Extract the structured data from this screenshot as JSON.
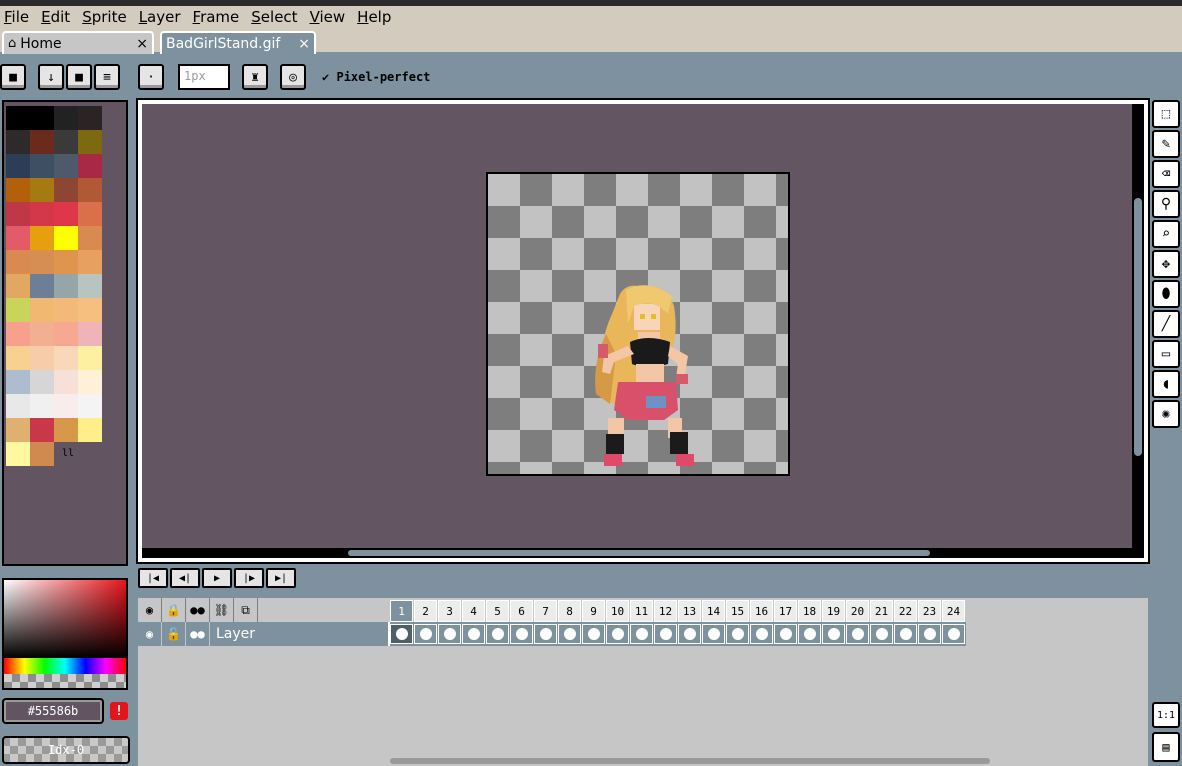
{
  "menubar": {
    "items": [
      "File",
      "Edit",
      "Sprite",
      "Layer",
      "Frame",
      "Select",
      "View",
      "Help"
    ]
  },
  "tabs": {
    "home": {
      "icon": "home-icon",
      "label": "Home",
      "close": "×"
    },
    "file": {
      "label": "BadGirlStand.gif",
      "close": "×"
    }
  },
  "toolbar": {
    "lock_icon": "lock-icon",
    "brush_size_value": "1px",
    "pixel_perfect_label": "Pixel-perfect",
    "pixel_perfect_checked": true
  },
  "palette": {
    "colors": [
      "#000000",
      "#000000",
      "#222222",
      "#2a2425",
      "#2f2a2a",
      "#6a2b1d",
      "#3a3a3a",
      "#7d6a10",
      "#2c3d57",
      "#3f4f63",
      "#4e5a6b",
      "#a82846",
      "#b3600a",
      "#a57a10",
      "#8e4632",
      "#b05a35",
      "#c03848",
      "#d33848",
      "#e0364a",
      "#d9704a",
      "#e35a68",
      "#e6a00f",
      "#ffff00",
      "#d88a50",
      "#d88a50",
      "#d68e52",
      "#e0954e",
      "#e8a060",
      "#e0a860",
      "#6d7e97",
      "#95a5a8",
      "#b8c4c0",
      "#c9d45a",
      "#f0b870",
      "#f4b878",
      "#f6bf80",
      "#f7a08e",
      "#f2b090",
      "#f6a890",
      "#f0b4b8",
      "#f8d090",
      "#f7cca8",
      "#f8d8b8",
      "#fdf0a0",
      "#adbccf",
      "#d6d6d6",
      "#f7e0d8",
      "#fff0d8",
      "#e8e8e8",
      "#f0f0f0",
      "#f8ecec",
      "#f4f4f4",
      "#e0b070",
      "#c83848",
      "#d8984a",
      "#ffef8a",
      "#fff8a0",
      "#d08a50"
    ],
    "count_label": "ll"
  },
  "color_picker": {
    "hex_value": "#55586b",
    "warning": "!",
    "index_label": "Idx-0"
  },
  "right_tools": [
    {
      "icon": "selection-icon",
      "glyph": "⬚"
    },
    {
      "icon": "pencil-icon",
      "glyph": "✎"
    },
    {
      "icon": "eraser-icon",
      "glyph": "⌫"
    },
    {
      "icon": "eyedropper-icon",
      "glyph": "⚲"
    },
    {
      "icon": "zoom-icon",
      "glyph": "⌕"
    },
    {
      "icon": "move-icon",
      "glyph": "✥"
    },
    {
      "icon": "paint-bucket-icon",
      "glyph": "⬮"
    },
    {
      "icon": "line-icon",
      "glyph": "╱"
    },
    {
      "icon": "rectangle-icon",
      "glyph": "▭"
    },
    {
      "icon": "curve-icon",
      "glyph": "◖"
    },
    {
      "icon": "spray-icon",
      "glyph": "✺"
    }
  ],
  "animation_controls": [
    {
      "icon": "first-frame-icon",
      "glyph": "|◀"
    },
    {
      "icon": "previous-frame-icon",
      "glyph": "◀|"
    },
    {
      "icon": "play-icon",
      "glyph": "▶"
    },
    {
      "icon": "next-frame-icon",
      "glyph": "|▶"
    },
    {
      "icon": "last-frame-icon",
      "glyph": "▶|"
    }
  ],
  "timeline": {
    "header_icons": [
      {
        "icon": "eye-icon",
        "glyph": "◉"
      },
      {
        "icon": "lock-icon",
        "glyph": "🔒"
      },
      {
        "icon": "continuous-icon",
        "glyph": "●●"
      },
      {
        "icon": "link-icon",
        "glyph": "⛓"
      },
      {
        "icon": "onion-skin-icon",
        "glyph": "⧉"
      }
    ],
    "frames": [
      "1",
      "2",
      "3",
      "4",
      "5",
      "6",
      "7",
      "8",
      "9",
      "10",
      "11",
      "12",
      "13",
      "14",
      "15",
      "16",
      "17",
      "18",
      "19",
      "20",
      "21",
      "22",
      "23",
      "24"
    ],
    "active_frame": 1,
    "layer": {
      "name": "Layer",
      "icons": [
        {
          "icon": "layer-visible-icon",
          "glyph": "◉"
        },
        {
          "icon": "layer-lock-icon",
          "glyph": "🔓"
        },
        {
          "icon": "layer-continuous-icon",
          "glyph": "●●"
        }
      ]
    }
  },
  "corner_buttons": {
    "ratio_label": "1:1",
    "film_icon": "filmstrip-icon"
  }
}
